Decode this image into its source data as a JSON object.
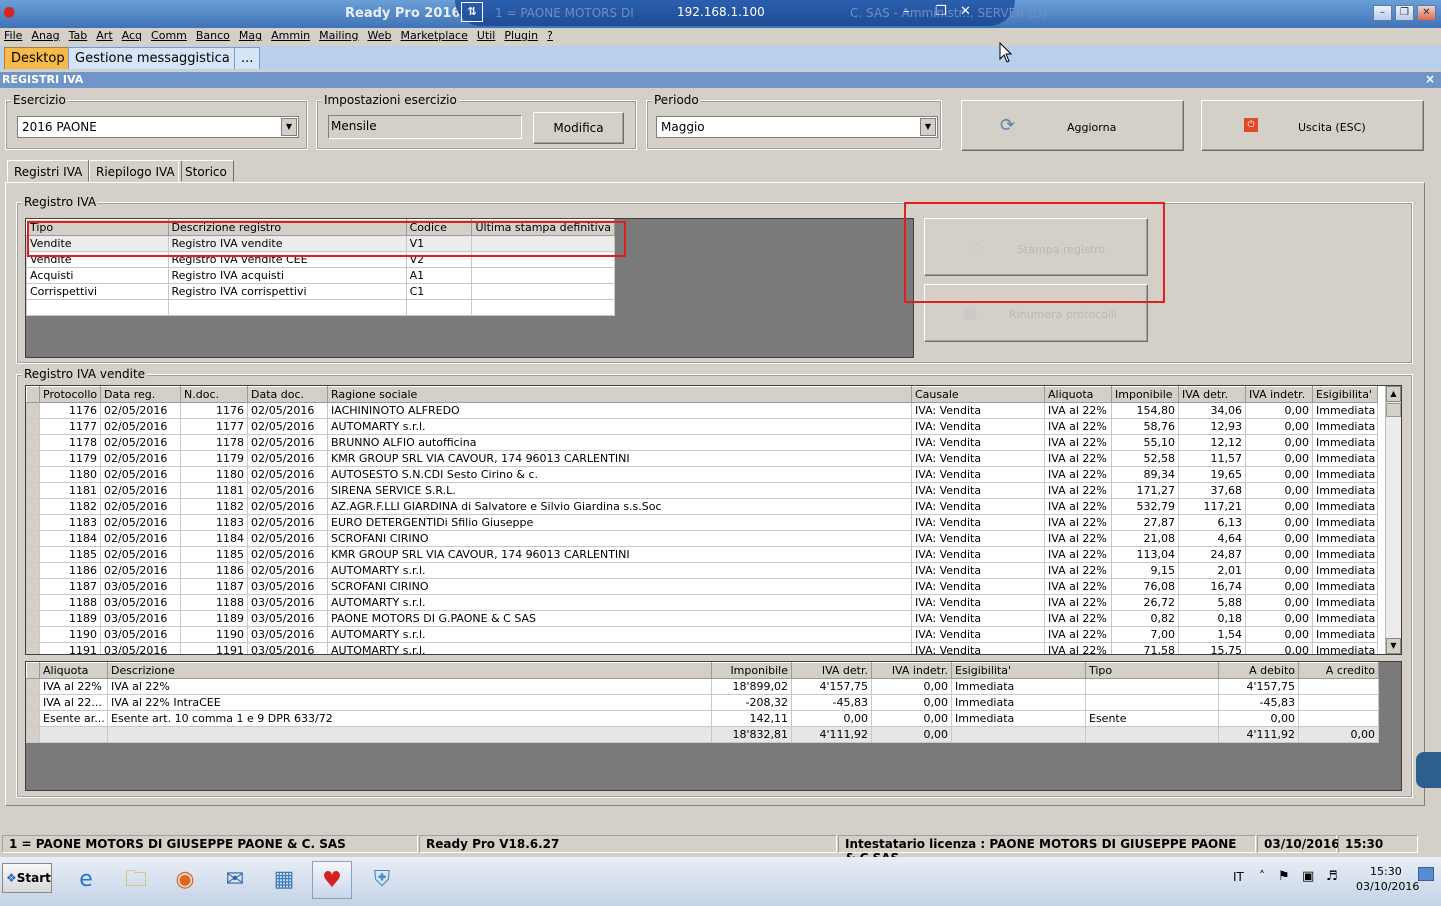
{
  "titlebar": {
    "app_title": "Ready Pro 2016",
    "remote_ip": "192.168.1.100",
    "ghost_left": "1 = PAONE MOTORS DI",
    "ghost_right": "C. SAS - Amministr... SERVER (D)",
    "pin_icon": "pin-icon",
    "app_icon": "strawberry-icon"
  },
  "menu": [
    "File",
    "Anag",
    "Tab",
    "Art",
    "Acq",
    "Comm",
    "Banco",
    "Mag",
    "Ammin",
    "Mailing",
    "Web",
    "Marketplace",
    "Util",
    "Plugin",
    "?"
  ],
  "doc_tabs": {
    "desktop": "Desktop",
    "messaging": "Gestione messaggistica",
    "more": "..."
  },
  "window_header": {
    "title": "REGISTRI IVA",
    "close": "×"
  },
  "esercizio": {
    "label": "Esercizio",
    "value": "2016 PAONE"
  },
  "impostazioni": {
    "label": "Impostazioni esercizio",
    "value": "Mensile",
    "button": "Modifica"
  },
  "periodo": {
    "label": "Periodo",
    "value": "Maggio"
  },
  "actions": {
    "aggiorna": "Aggiorna",
    "uscita": "Uscita (ESC)"
  },
  "tabs": [
    "Registri IVA",
    "Riepilogo IVA",
    "Storico"
  ],
  "registri_group": {
    "label": "Registro IVA",
    "columns": [
      "Tipo",
      "Descrizione registro",
      "Codice",
      "Ultima stampa definitiva"
    ],
    "rows": [
      [
        "Vendite",
        "Registro IVA vendite",
        "V1",
        ""
      ],
      [
        "Vendite",
        "Registro IVA vendite CEE",
        "V2",
        ""
      ],
      [
        "Acquisti",
        "Registro IVA acquisti",
        "A1",
        ""
      ],
      [
        "Corrispettivi",
        "Registro IVA corrispettivi",
        "C1",
        ""
      ]
    ],
    "stampa_button": "Stampa registro",
    "rinumera_button": "Rinumera protocolli"
  },
  "vendite_group": {
    "label": "Registro IVA vendite",
    "columns": [
      "Protocollo",
      "Data reg.",
      "N.doc.",
      "Data doc.",
      "Ragione sociale",
      "Causale",
      "Aliquota",
      "Imponibile",
      "IVA detr.",
      "IVA indetr.",
      "Esigibilita'"
    ],
    "rows": [
      [
        "1176",
        "02/05/2016",
        "1176",
        "02/05/2016",
        "IACHININOTO ALFREDO",
        "IVA: Vendita",
        "IVA al 22%",
        "154,80",
        "34,06",
        "0,00",
        "Immediata"
      ],
      [
        "1177",
        "02/05/2016",
        "1177",
        "02/05/2016",
        "AUTOMARTY s.r.l.",
        "IVA: Vendita",
        "IVA al 22%",
        "58,76",
        "12,93",
        "0,00",
        "Immediata"
      ],
      [
        "1178",
        "02/05/2016",
        "1178",
        "02/05/2016",
        "BRUNNO ALFIO autofficina",
        "IVA: Vendita",
        "IVA al 22%",
        "55,10",
        "12,12",
        "0,00",
        "Immediata"
      ],
      [
        "1179",
        "02/05/2016",
        "1179",
        "02/05/2016",
        "KMR GROUP SRL        VIA CAVOUR, 174 96013 CARLENTINI",
        "IVA: Vendita",
        "IVA al 22%",
        "52,58",
        "11,57",
        "0,00",
        "Immediata"
      ],
      [
        "1180",
        "02/05/2016",
        "1180",
        "02/05/2016",
        "AUTOSESTO S.N.CDI Sesto Cirino & c.",
        "IVA: Vendita",
        "IVA al 22%",
        "89,34",
        "19,65",
        "0,00",
        "Immediata"
      ],
      [
        "1181",
        "02/05/2016",
        "1181",
        "02/05/2016",
        "SIRENA SERVICE S.R.L.",
        "IVA: Vendita",
        "IVA al 22%",
        "171,27",
        "37,68",
        "0,00",
        "Immediata"
      ],
      [
        "1182",
        "02/05/2016",
        "1182",
        "02/05/2016",
        "AZ.AGR.F.LLI GIARDINA di Salvatore e Silvio Giardina s.s.Soc",
        "IVA: Vendita",
        "IVA al 22%",
        "532,79",
        "117,21",
        "0,00",
        "Immediata"
      ],
      [
        "1183",
        "02/05/2016",
        "1183",
        "02/05/2016",
        "EURO DETERGENTIDi Sfilio Giuseppe",
        "IVA: Vendita",
        "IVA al 22%",
        "27,87",
        "6,13",
        "0,00",
        "Immediata"
      ],
      [
        "1184",
        "02/05/2016",
        "1184",
        "02/05/2016",
        "SCROFANI CIRINO",
        "IVA: Vendita",
        "IVA al 22%",
        "21,08",
        "4,64",
        "0,00",
        "Immediata"
      ],
      [
        "1185",
        "02/05/2016",
        "1185",
        "02/05/2016",
        "KMR GROUP SRL        VIA CAVOUR, 174 96013 CARLENTINI",
        "IVA: Vendita",
        "IVA al 22%",
        "113,04",
        "24,87",
        "0,00",
        "Immediata"
      ],
      [
        "1186",
        "02/05/2016",
        "1186",
        "02/05/2016",
        "AUTOMARTY s.r.l.",
        "IVA: Vendita",
        "IVA al 22%",
        "9,15",
        "2,01",
        "0,00",
        "Immediata"
      ],
      [
        "1187",
        "03/05/2016",
        "1187",
        "03/05/2016",
        "SCROFANI CIRINO",
        "IVA: Vendita",
        "IVA al 22%",
        "76,08",
        "16,74",
        "0,00",
        "Immediata"
      ],
      [
        "1188",
        "03/05/2016",
        "1188",
        "03/05/2016",
        "AUTOMARTY s.r.l.",
        "IVA: Vendita",
        "IVA al 22%",
        "26,72",
        "5,88",
        "0,00",
        "Immediata"
      ],
      [
        "1189",
        "03/05/2016",
        "1189",
        "03/05/2016",
        "PAONE MOTORS DI G.PAONE & C SAS",
        "IVA: Vendita",
        "IVA al 22%",
        "0,82",
        "0,18",
        "0,00",
        "Immediata"
      ],
      [
        "1190",
        "03/05/2016",
        "1190",
        "03/05/2016",
        "AUTOMARTY s.r.l.",
        "IVA: Vendita",
        "IVA al 22%",
        "7,00",
        "1,54",
        "0,00",
        "Immediata"
      ],
      [
        "1191",
        "03/05/2016",
        "1191",
        "03/05/2016",
        "AUTOMARTY s.r.l.",
        "IVA: Vendita",
        "IVA al 22%",
        "71,58",
        "15,75",
        "0,00",
        "Immediata"
      ]
    ]
  },
  "summary": {
    "columns": [
      "Aliquota",
      "Descrizione",
      "Imponibile",
      "IVA detr.",
      "IVA indetr.",
      "Esigibilita'",
      "Tipo",
      "A debito",
      "A credito"
    ],
    "rows": [
      [
        "IVA al 22%",
        "IVA al 22%",
        "18'899,02",
        "4'157,75",
        "0,00",
        "Immediata",
        "",
        "4'157,75",
        ""
      ],
      [
        "IVA al 22...",
        "IVA al 22% IntraCEE",
        "-208,32",
        "-45,83",
        "0,00",
        "Immediata",
        "",
        "-45,83",
        ""
      ],
      [
        "Esente ar...",
        "Esente art. 10 comma 1 e 9 DPR 633/72",
        "142,11",
        "0,00",
        "0,00",
        "Immediata",
        "Esente",
        "0,00",
        ""
      ]
    ],
    "totals": [
      "",
      "",
      "18'832,81",
      "4'111,92",
      "0,00",
      "",
      "",
      "4'111,92",
      "0,00"
    ]
  },
  "status": {
    "company": "1 = PAONE MOTORS DI GIUSEPPE PAONE & C. SAS",
    "version": "Ready Pro V18.6.27",
    "license": "Intestatario licenza : PAONE MOTORS DI GIUSEPPE PAONE & C SAS",
    "date": "03/10/2016",
    "time": "15:30"
  },
  "taskbar": {
    "start": "Start",
    "lang": "IT",
    "clock_time": "15:30",
    "clock_date": "03/10/2016",
    "icons": [
      "ie-icon",
      "explorer-icon",
      "firefox-icon",
      "thunderbird-icon",
      "calculator-icon",
      "readypro-icon",
      "shield-app-icon"
    ]
  }
}
